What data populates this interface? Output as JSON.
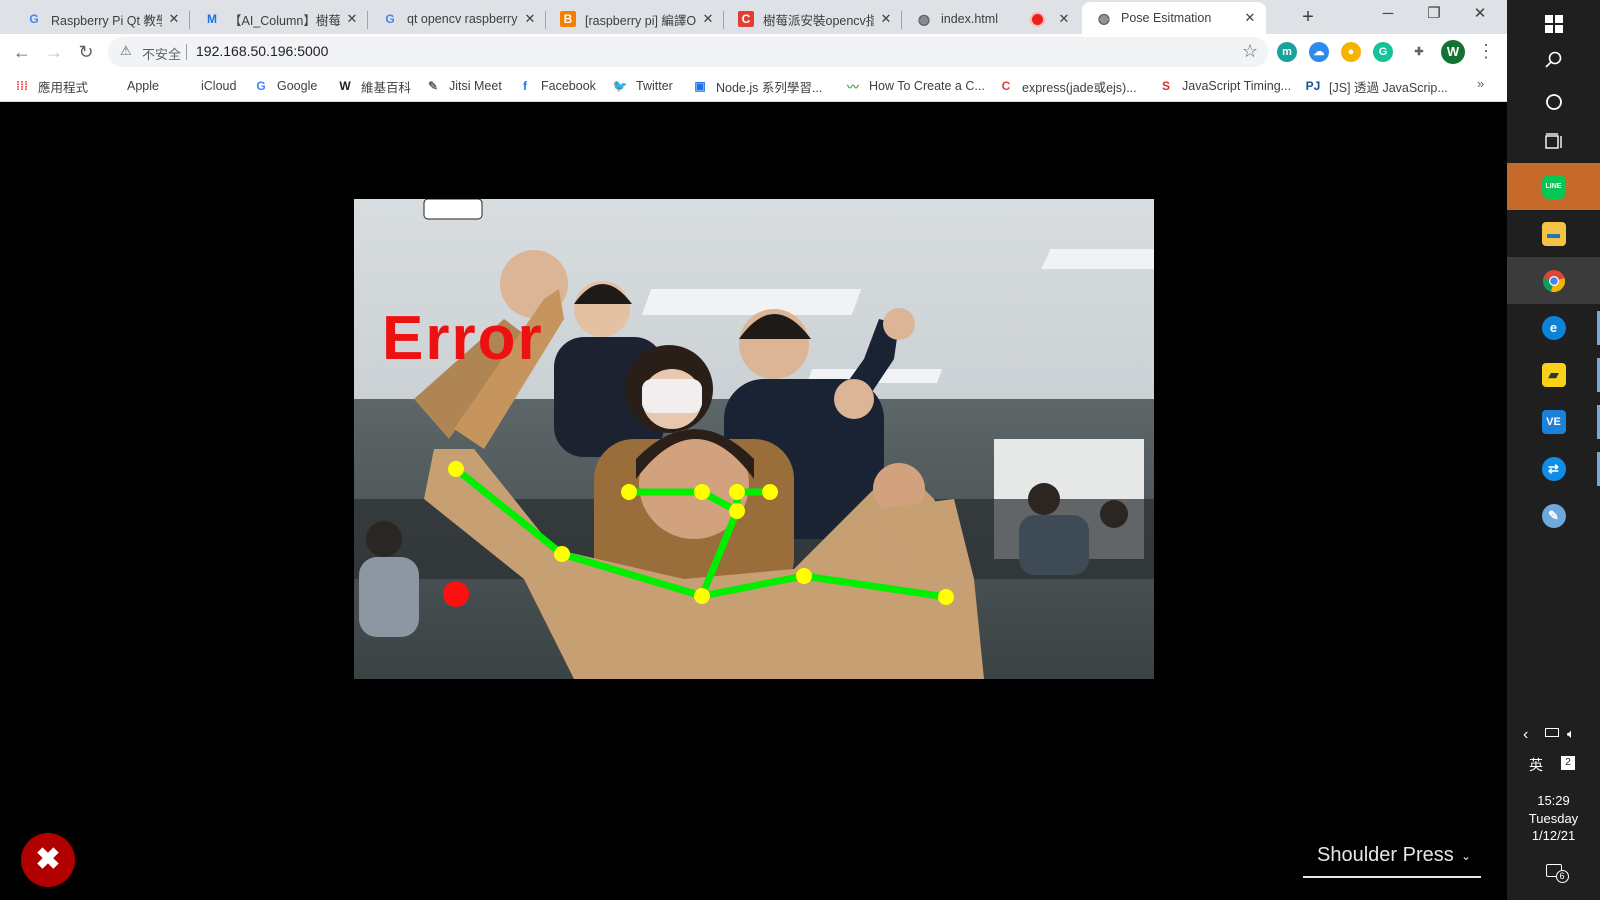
{
  "browser": {
    "tabs": [
      {
        "icon": "google-icon",
        "title": "Raspberry Pi Qt 教學",
        "close": "✕"
      },
      {
        "icon": "medium-icon",
        "title": "【AI_Column】樹莓派",
        "close": "✕"
      },
      {
        "icon": "google-icon",
        "title": "qt opencv raspberry",
        "close": "✕"
      },
      {
        "icon": "blogger-icon",
        "title": "[raspberry pi] 編譯Op",
        "close": "✕"
      },
      {
        "icon": "csdn-icon",
        "title": "樹莓派安裝opencv指",
        "close": "✕"
      },
      {
        "icon": "globe-icon",
        "title": "index.html",
        "close": "✕"
      },
      {
        "icon": "globe-icon",
        "title": "Pose Esitmation",
        "close": "✕"
      }
    ],
    "new_tab": "+",
    "window_controls": {
      "minimize": "─",
      "restore": "❐",
      "close": "✕"
    },
    "nav": {
      "back": "←",
      "forward": "→",
      "reload": "↻"
    },
    "address": {
      "security_icon": "⚠",
      "security_label": "不安全",
      "url": "192.168.50.196:5000",
      "star": "☆"
    },
    "extensions": [
      {
        "name": "m-extension-icon",
        "glyph": "m",
        "color": "#1aa39a"
      },
      {
        "name": "cloud-extension-icon",
        "glyph": "☁",
        "color": "#2d8ceb"
      },
      {
        "name": "color-extension-icon",
        "glyph": "●",
        "color": "#f4b400"
      },
      {
        "name": "grammarly-icon",
        "glyph": "G",
        "color": "#15c39a"
      },
      {
        "name": "puzzle-icon",
        "glyph": "✚",
        "color": "#5f6368"
      }
    ],
    "profile_initial": "W",
    "menu": "⋮",
    "bookmarks": [
      {
        "icon": "apps-grid-icon",
        "glyph": "⁞⁞⁞",
        "label": "應用程式"
      },
      {
        "icon": "apple-icon",
        "glyph": "",
        "label": "Apple"
      },
      {
        "icon": "icloud-icon",
        "glyph": "",
        "label": "iCloud"
      },
      {
        "icon": "google-icon",
        "glyph": "G",
        "label": "Google"
      },
      {
        "icon": "wikipedia-icon",
        "glyph": "W",
        "label": "維基百科"
      },
      {
        "icon": "jitsi-icon",
        "glyph": "✎",
        "label": "Jitsi Meet"
      },
      {
        "icon": "facebook-icon",
        "glyph": "f",
        "label": "Facebook"
      },
      {
        "icon": "twitter-icon",
        "glyph": "🐦",
        "label": "Twitter"
      },
      {
        "icon": "ithome-icon",
        "glyph": "▣",
        "label": "Node.js 系列學習..."
      },
      {
        "icon": "howto-icon",
        "glyph": "〰",
        "label": "How To Create a C..."
      },
      {
        "icon": "csdn-icon",
        "glyph": "C",
        "label": "express(jade或ejs)..."
      },
      {
        "icon": "js-timing-icon",
        "glyph": "S",
        "label": "JavaScript Timing..."
      },
      {
        "icon": "pj-icon",
        "glyph": "PJ",
        "label": "[JS] 透過 JavaScrip..."
      }
    ],
    "bookmarks_more": "»"
  },
  "page": {
    "overlay_text": "Error",
    "close_button_glyph": "✖",
    "exercise_select": {
      "value": "Shoulder Press",
      "chevron": "⌄"
    }
  },
  "colors": {
    "skeleton_line": "#00ee00",
    "keypoint": "#ffff00",
    "error_text": "#ee1111",
    "close_fab": "#b00000"
  },
  "taskbar": {
    "start_icon": "windows-start-icon",
    "search_icon": "search-icon",
    "cortana_icon": "cortana-circle-icon",
    "taskview_icon": "task-view-icon",
    "apps": [
      {
        "name": "line-app",
        "label": "LINE"
      },
      {
        "name": "file-explorer-app",
        "label": "▬"
      },
      {
        "name": "chrome-app",
        "label": "◉"
      },
      {
        "name": "edge-app",
        "label": "e"
      },
      {
        "name": "sticky-notes-app",
        "label": "▰"
      },
      {
        "name": "vnc-viewer-app",
        "label": "VE"
      },
      {
        "name": "teamviewer-app",
        "label": "⇄"
      },
      {
        "name": "paint-app",
        "label": "✎"
      }
    ],
    "tray": {
      "chevron": "‹",
      "ime": "英",
      "time": "15:29",
      "day": "Tuesday",
      "date": "1/12/21",
      "notifications": "6"
    }
  }
}
